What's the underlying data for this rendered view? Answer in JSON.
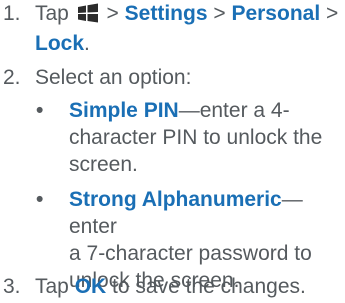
{
  "steps": [
    {
      "number": "1.",
      "tap": "Tap",
      "settings": "Settings",
      "personal": "Personal",
      "lock": "Lock",
      "sep": ">",
      "end": "."
    },
    {
      "number": "2.",
      "text": "Select an option:"
    },
    {
      "number": "3.",
      "tap": "Tap",
      "ok": "OK",
      "rest": "to save the changes."
    }
  ],
  "options": [
    {
      "bullet": "•",
      "name": "Simple PIN",
      "desc_line1": "—enter a 4-",
      "desc_line2": "character PIN to unlock the",
      "desc_line3": "screen."
    },
    {
      "bullet": "•",
      "name": "Strong Alphanumeric",
      "desc_line1": "—enter",
      "desc_line2": "a 7-character password to",
      "desc_line3": "unlock the screen."
    }
  ],
  "colors": {
    "keyword": "#1a6fb5",
    "text": "#555a5e"
  },
  "icons": {
    "start": "windows-start-icon"
  }
}
